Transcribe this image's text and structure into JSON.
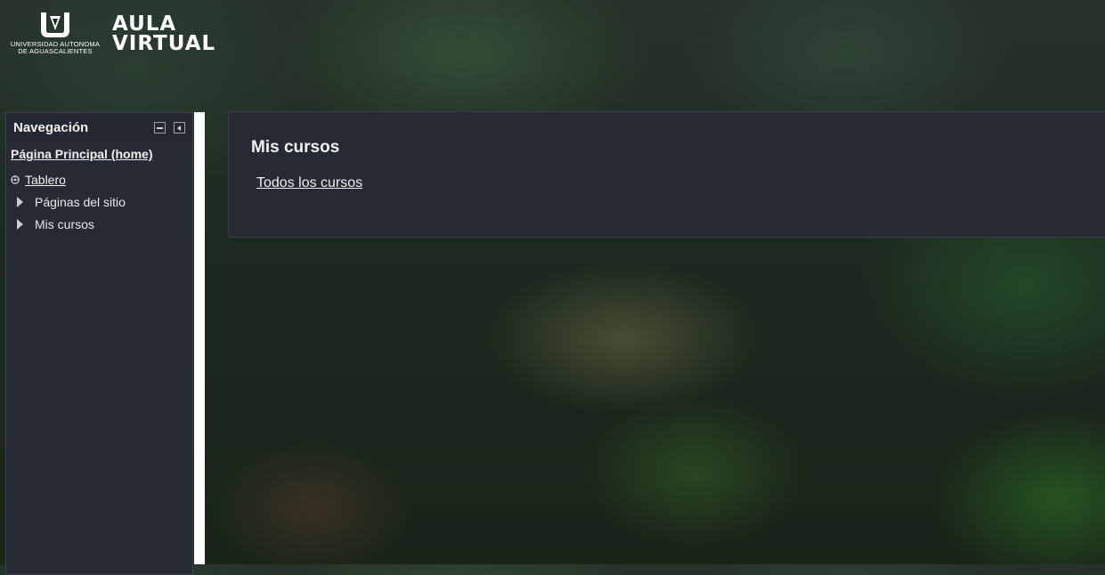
{
  "brand": {
    "university_line1": "UNIVERSIDAD AUTONOMA",
    "university_line2": "DE AGUASCALIENTES",
    "app_line1": "AULA",
    "app_line2": "VIRTUAL"
  },
  "navigation": {
    "title": "Navegación",
    "home_link": "Página Principal (home)",
    "items": [
      {
        "label": "Tablero",
        "icon": "dashboard-icon"
      },
      {
        "label": "Páginas del sitio",
        "icon": "chevron-right-icon"
      },
      {
        "label": "Mis cursos",
        "icon": "chevron-right-icon"
      }
    ]
  },
  "main": {
    "section_title": "Mis cursos",
    "all_courses_link": "Todos los cursos"
  }
}
